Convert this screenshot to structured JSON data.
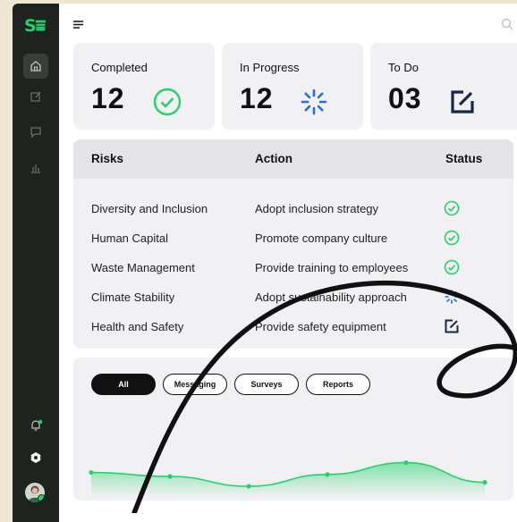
{
  "brand": {
    "logo_text": "S⩸"
  },
  "nav": {
    "items": [
      {
        "name": "home-icon",
        "active": true
      },
      {
        "name": "edit-icon",
        "active": false
      },
      {
        "name": "chat-icon",
        "active": false
      },
      {
        "name": "analytics-icon",
        "active": false
      }
    ]
  },
  "colors": {
    "accent": "#22d36a",
    "progress": "#1e6fe8",
    "dark": "#1f2320"
  },
  "cards": [
    {
      "label": "Completed",
      "value": "12",
      "icon": "check-circle-icon"
    },
    {
      "label": "In Progress",
      "value": "12",
      "icon": "loading-icon"
    },
    {
      "label": "To Do",
      "value": "03",
      "icon": "edit-square-icon"
    }
  ],
  "table": {
    "headers": [
      "Risks",
      "Action",
      "Status"
    ],
    "rows": [
      {
        "risk": "Diversity and Inclusion",
        "action": "Adopt inclusion strategy",
        "status": "completed"
      },
      {
        "risk": "Human Capital",
        "action": "Promote company culture",
        "status": "completed"
      },
      {
        "risk": "Waste Management",
        "action": "Provide training to employees",
        "status": "completed"
      },
      {
        "risk": "Climate Stability",
        "action": "Adopt sustainability approach",
        "status": "in-progress"
      },
      {
        "risk": "Health and Safety",
        "action": "Provide safety equipment",
        "status": "to-do"
      }
    ]
  },
  "filters": [
    "All",
    "Messaging",
    "Surveys",
    "Reports"
  ],
  "active_filter": "All",
  "chart_data": {
    "type": "area",
    "x": [
      1,
      2,
      3,
      4,
      5,
      6
    ],
    "series": [
      {
        "values": [
          52,
          48,
          38,
          50,
          62,
          42
        ]
      }
    ],
    "ylim": [
      0,
      100
    ],
    "title": "",
    "xlabel": "",
    "ylabel": ""
  }
}
